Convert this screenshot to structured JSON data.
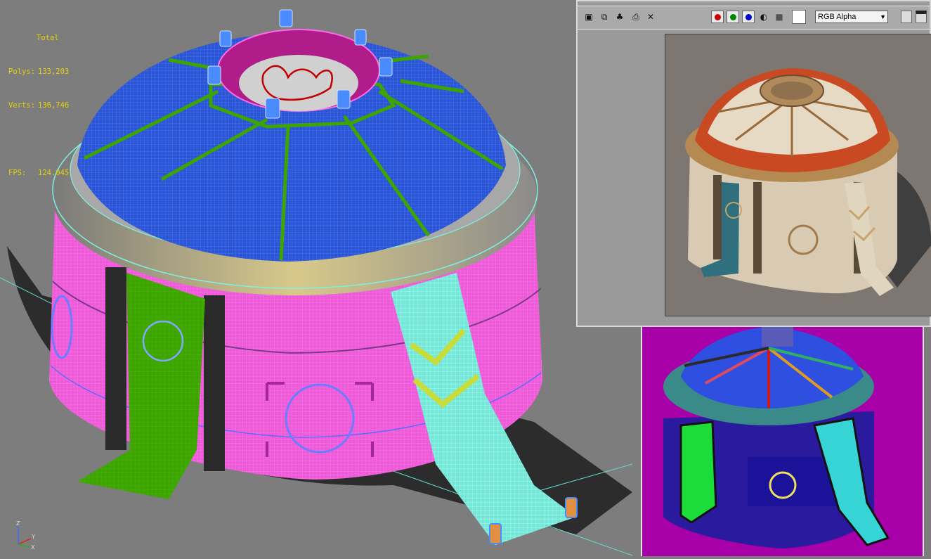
{
  "stats": {
    "header": "Total",
    "polys_label": "Polys:",
    "polys_value": "133,203",
    "verts_label": "Verts:",
    "verts_value": "136,746",
    "fps_label": "FPS:",
    "fps_value": "124.045"
  },
  "render_window": {
    "channel_select": "RGB Alpha",
    "toolbar_icons": [
      "save-icon",
      "copy-icon",
      "clone-icon",
      "print-icon",
      "clear-icon"
    ],
    "channels": {
      "red": "#cc0000",
      "green": "#008800",
      "blue": "#0000cc"
    }
  },
  "axis": {
    "z": "Z",
    "y": "Y",
    "x": "X"
  },
  "colors": {
    "viewport_bg": "#7d7d7d",
    "stats_text": "#e6d200",
    "wire_pink": "#ff58ff",
    "wire_blue": "#2f66ff",
    "wire_green": "#3ea400",
    "wire_cyan": "#7ff0e0",
    "uv_bg": "#a800a8"
  }
}
